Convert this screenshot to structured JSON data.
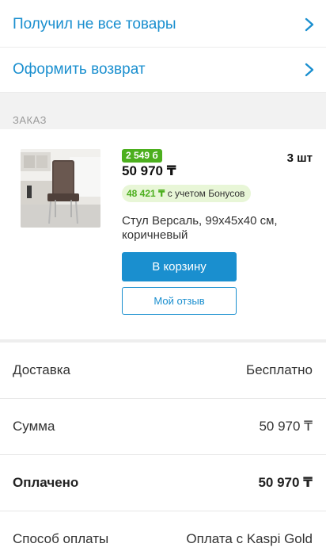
{
  "links": [
    {
      "label": "Получил не все товары"
    },
    {
      "label": "Оформить возврат"
    }
  ],
  "section": {
    "title": "ЗАКАЗ"
  },
  "product": {
    "bonus_badge": "2 549 б",
    "price": "50 970 ₸",
    "quantity": "3 шт",
    "bonus_price": "48 421 ₸",
    "bonus_suffix": " с учетом Бонусов",
    "title": "Стул Версаль, 99х45х40 см, коричневый",
    "cart_button": "В корзину",
    "review_button": "Мой отзыв"
  },
  "details": [
    {
      "label": "Доставка",
      "value": "Бесплатно"
    },
    {
      "label": "Сумма",
      "value": "50 970 ₸"
    },
    {
      "label": "Оплачено",
      "value": "50 970 ₸"
    },
    {
      "label": "Способ оплаты",
      "value": "Оплата с Kaspi Gold"
    }
  ],
  "colors": {
    "accent": "#1a8fcf",
    "bonus_green": "#4caf1e",
    "bonus_bg": "#e8f6d7"
  },
  "icons": {
    "link_arrow": "chevron-right-icon"
  }
}
